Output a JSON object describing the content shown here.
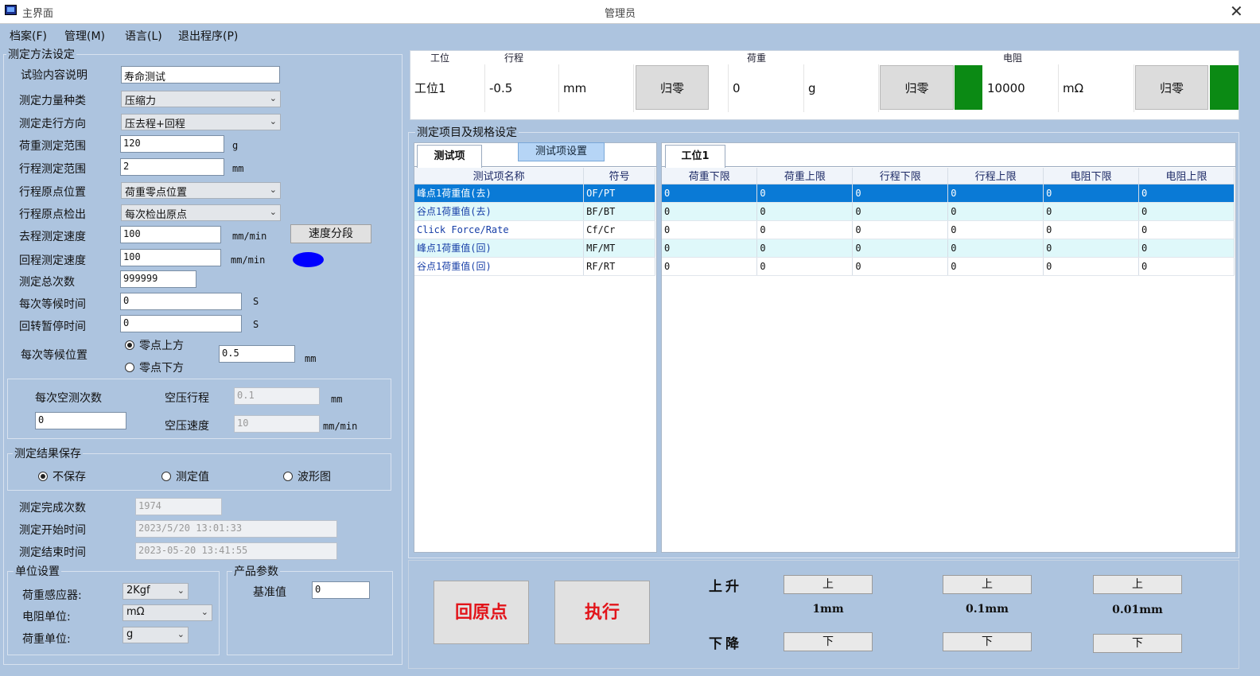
{
  "window": {
    "title": "主界面",
    "user": "管理员",
    "close": "✕"
  },
  "menu": [
    "档案(F)",
    "管理(M)",
    "语言(L)",
    "退出程序(P)"
  ],
  "method": {
    "group_title": "测定方法设定",
    "desc_label": "试验内容说明",
    "desc_value": "寿命测试",
    "force_type_label": "测定力量种类",
    "force_type_value": "压缩力",
    "direction_label": "测定走行方向",
    "direction_value": "压去程+回程",
    "load_range_label": "荷重测定范围",
    "load_range_value": "120",
    "load_range_unit": "g",
    "stroke_range_label": "行程测定范围",
    "stroke_range_value": "2",
    "stroke_range_unit": "mm",
    "origin_pos_label": "行程原点位置",
    "origin_pos_value": "荷重零点位置",
    "origin_detect_label": "行程原点检出",
    "origin_detect_value": "每次检出原点",
    "fwd_speed_label": "去程测定速度",
    "fwd_speed_value": "100",
    "fwd_speed_unit": "mm/min",
    "speed_seg_button": "速度分段",
    "ret_speed_label": "回程测定速度",
    "ret_speed_value": "100",
    "ret_speed_unit": "mm/min",
    "indicator_color": "#0000ff",
    "total_count_label": "测定总次数",
    "total_count_value": "999999",
    "wait_time_label": "每次等候时间",
    "wait_time_value": "0",
    "wait_time_unit": "S",
    "pause_time_label": "回转暂停时间",
    "pause_time_value": "0",
    "pause_time_unit": "S",
    "wait_pos_label": "每次等候位置",
    "wait_pos_above": "零点上方",
    "wait_pos_below": "零点下方",
    "wait_pos_selected": "above",
    "wait_pos_value": "0.5",
    "wait_pos_unit": "mm"
  },
  "empty_test": {
    "count_label": "每次空测次数",
    "count_value": "0",
    "stroke_label": "空压行程",
    "stroke_value": "0.1",
    "stroke_unit": "mm",
    "speed_label": "空压速度",
    "speed_value": "10",
    "speed_unit": "mm/min"
  },
  "save": {
    "group_title": "测定结果保存",
    "opt_none": "不保存",
    "opt_value": "测定值",
    "opt_wave": "波形图",
    "selected": "none"
  },
  "progress": {
    "done_label": "测定完成次数",
    "done_value": "1974",
    "start_label": "测定开始时间",
    "start_value": "2023/5/20 13:01:33",
    "end_label": "测定结束时间",
    "end_value": "2023-05-20 13:41:55"
  },
  "units": {
    "group_title": "单位设置",
    "sensor_label": "荷重感应器:",
    "sensor_value": "2Kgf",
    "resist_label": "电阻单位:",
    "resist_value": "mΩ",
    "load_label": "荷重单位:",
    "load_value": "g"
  },
  "product": {
    "group_title": "产品参数",
    "ref_label": "基准值",
    "ref_value": "0"
  },
  "status": {
    "headers": {
      "station": "工位",
      "stroke": "行程",
      "load": "荷重",
      "resist": "电阻"
    },
    "station": "工位1",
    "stroke_value": "-0.5",
    "stroke_unit": "mm",
    "load_value": "0",
    "load_unit": "g",
    "resist_value": "10000",
    "resist_unit": "mΩ",
    "zero_label": "归零",
    "indicator_color": "#0b8a14"
  },
  "spec": {
    "group_title": "测定项目及规格设定",
    "tab_items": "测试项",
    "tab_settings_button": "测试项设置",
    "tab_station": "工位1",
    "item_headers": [
      "测试项名称",
      "符号"
    ],
    "items": [
      {
        "name": "峰点1荷重值(去)",
        "symbol": "OF/PT"
      },
      {
        "name": "谷点1荷重值(去)",
        "symbol": "BF/BT"
      },
      {
        "name": "Click Force/Rate",
        "symbol": "Cf/Cr"
      },
      {
        "name": "峰点1荷重值(回)",
        "symbol": "MF/MT"
      },
      {
        "name": "谷点1荷重值(回)",
        "symbol": "RF/RT"
      }
    ],
    "limit_headers": [
      "荷重下限",
      "荷重上限",
      "行程下限",
      "行程上限",
      "电阻下限",
      "电阻上限"
    ],
    "limits": [
      [
        "0",
        "0",
        "0",
        "0",
        "0",
        "0"
      ],
      [
        "0",
        "0",
        "0",
        "0",
        "0",
        "0"
      ],
      [
        "0",
        "0",
        "0",
        "0",
        "0",
        "0"
      ],
      [
        "0",
        "0",
        "0",
        "0",
        "0",
        "0"
      ],
      [
        "0",
        "0",
        "0",
        "0",
        "0",
        "0"
      ]
    ],
    "selected_row": 0,
    "selection_color": "#0a7ad6"
  },
  "controls": {
    "home_button": "回原点",
    "run_button": "执行",
    "up_label": "上升",
    "down_label": "下降",
    "up_button": "上",
    "down_button": "下",
    "steps": [
      "1mm",
      "0.1mm",
      "0.01mm"
    ]
  }
}
